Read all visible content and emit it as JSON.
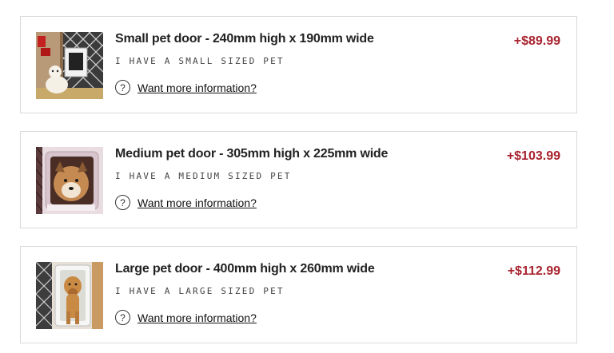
{
  "options": [
    {
      "title": "Small pet door - 240mm high x 190mm wide",
      "subtitle": "I HAVE A SMALL SIZED PET",
      "info_link": "Want more information?",
      "info_icon": "question-icon",
      "price": "+$89.99",
      "image": "small-dog-at-pet-door"
    },
    {
      "title": "Medium pet door - 305mm high x 225mm wide",
      "subtitle": "I HAVE A MEDIUM SIZED PET",
      "info_link": "Want more information?",
      "info_icon": "question-icon",
      "price": "+$103.99",
      "image": "medium-dog-through-pet-door"
    },
    {
      "title": "Large pet door - 400mm high x 260mm wide",
      "subtitle": "I HAVE A LARGE SIZED PET",
      "info_link": "Want more information?",
      "info_icon": "question-icon",
      "price": "+$112.99",
      "image": "large-dog-through-pet-door"
    }
  ],
  "colors": {
    "price": "#a8232f",
    "border": "#d9d9d9",
    "text": "#222222"
  }
}
